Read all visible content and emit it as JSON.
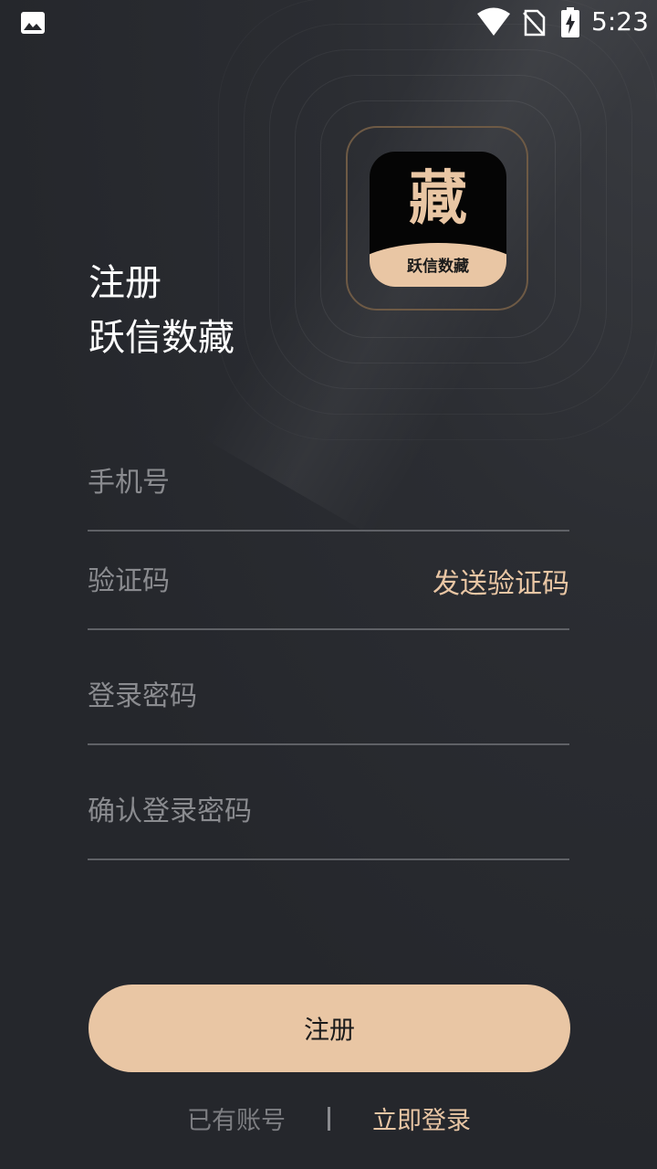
{
  "status_bar": {
    "time": "5:23",
    "icons": [
      "gallery-icon",
      "wifi-icon",
      "no-sim-icon",
      "battery-charging-icon"
    ]
  },
  "logo": {
    "char": "藏",
    "name": "跃信数藏"
  },
  "title": {
    "line1": "注册",
    "line2": "跃信数藏"
  },
  "form": {
    "phone_placeholder": "手机号",
    "code_placeholder": "验证码",
    "send_code_label": "发送验证码",
    "password_placeholder": "登录密码",
    "confirm_password_placeholder": "确认登录密码"
  },
  "register_button_label": "注册",
  "footer": {
    "have_account": "已有账号",
    "login_now": "立即登录"
  },
  "colors": {
    "background": "#25272c",
    "accent": "#e9c6a4",
    "placeholder": "#8a8b8f",
    "divider": "#5f6166"
  }
}
